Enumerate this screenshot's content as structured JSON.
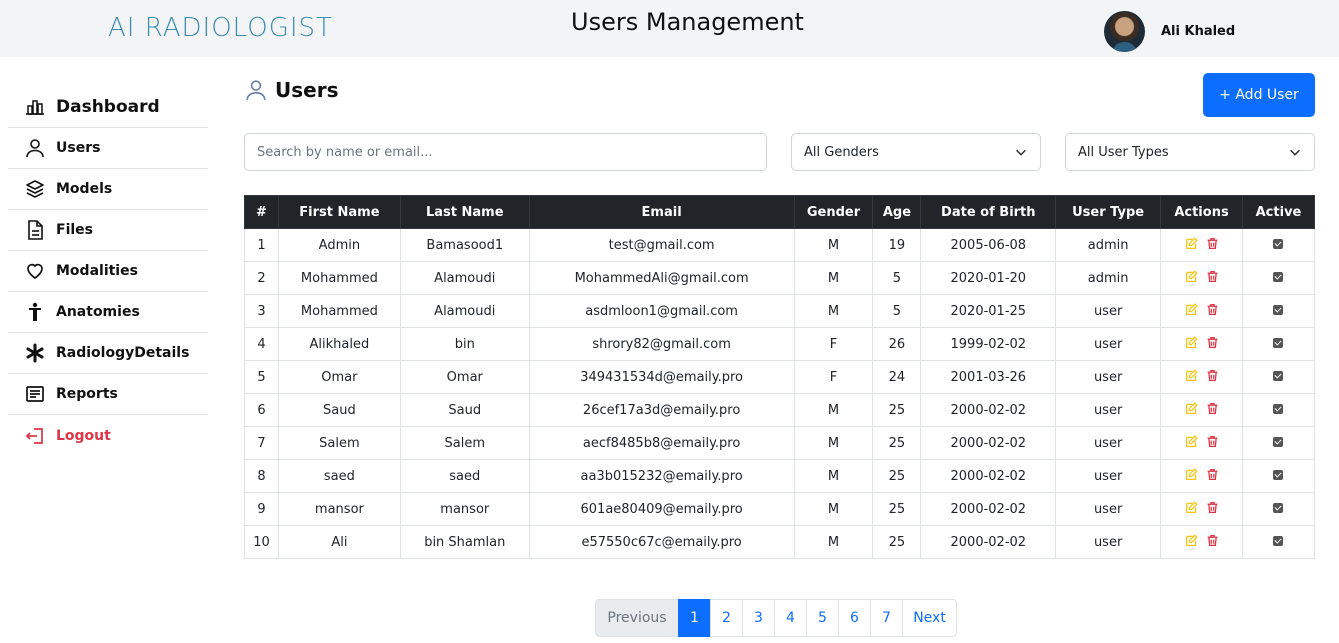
{
  "header": {
    "logo": "AI RADIOLOGIST",
    "title": "Users Management",
    "user_name": "Ali Khaled"
  },
  "sidebar": {
    "items": [
      {
        "label": "Dashboard",
        "icon": "dashboard-icon"
      },
      {
        "label": "Users",
        "icon": "user-icon"
      },
      {
        "label": "Models",
        "icon": "layers-icon"
      },
      {
        "label": "Files",
        "icon": "file-icon"
      },
      {
        "label": "Modalities",
        "icon": "heart-icon"
      },
      {
        "label": "Anatomies",
        "icon": "person-icon"
      },
      {
        "label": "RadiologyDetails",
        "icon": "asterisk-icon"
      },
      {
        "label": "Reports",
        "icon": "report-icon"
      },
      {
        "label": "Logout",
        "icon": "logout-icon"
      }
    ]
  },
  "main": {
    "section_title": "Users",
    "add_button": "+ Add User",
    "search_placeholder": "Search by name or email...",
    "gender_filter": "All Genders",
    "type_filter": "All User Types"
  },
  "table": {
    "headers": [
      "#",
      "First Name",
      "Last Name",
      "Email",
      "Gender",
      "Age",
      "Date of Birth",
      "User Type",
      "Actions",
      "Active"
    ],
    "rows": [
      [
        "1",
        "Admin",
        "Bamasood1",
        "test@gmail.com",
        "M",
        "19",
        "2005-06-08",
        "admin"
      ],
      [
        "2",
        "Mohammed",
        "Alamoudi",
        "MohammedAli@gmail.com",
        "M",
        "5",
        "2020-01-20",
        "admin"
      ],
      [
        "3",
        "Mohammed",
        "Alamoudi",
        "asdmloon1@gmail.com",
        "M",
        "5",
        "2020-01-25",
        "user"
      ],
      [
        "4",
        "Alikhaled",
        "bin",
        "shrory82@gmail.com",
        "F",
        "26",
        "1999-02-02",
        "user"
      ],
      [
        "5",
        "Omar",
        "Omar",
        "349431534d@emaily.pro",
        "F",
        "24",
        "2001-03-26",
        "user"
      ],
      [
        "6",
        "Saud",
        "Saud",
        "26cef17a3d@emaily.pro",
        "M",
        "25",
        "2000-02-02",
        "user"
      ],
      [
        "7",
        "Salem",
        "Salem",
        "aecf8485b8@emaily.pro",
        "M",
        "25",
        "2000-02-02",
        "user"
      ],
      [
        "8",
        "saed",
        "saed",
        "aa3b015232@emaily.pro",
        "M",
        "25",
        "2000-02-02",
        "user"
      ],
      [
        "9",
        "mansor",
        "mansor",
        "601ae80409@emaily.pro",
        "M",
        "25",
        "2000-02-02",
        "user"
      ],
      [
        "10",
        "Ali",
        "bin Shamlan",
        "e57550c67c@emaily.pro",
        "M",
        "25",
        "2000-02-02",
        "user"
      ]
    ]
  },
  "pagination": {
    "previous": "Previous",
    "pages": [
      "1",
      "2",
      "3",
      "4",
      "5",
      "6",
      "7"
    ],
    "active": "1",
    "next": "Next"
  },
  "colors": {
    "primary": "#0d6efd",
    "logout": "#dc3545",
    "edit_icon": "#f5c518",
    "delete_icon": "#dc3545",
    "table_header": "#212529"
  }
}
